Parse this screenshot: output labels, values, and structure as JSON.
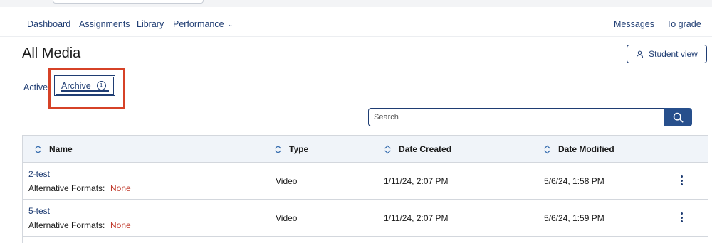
{
  "nav": {
    "left": [
      {
        "label": "Dashboard"
      },
      {
        "label": "Assignments"
      },
      {
        "label": "Library"
      },
      {
        "label": "Performance"
      }
    ],
    "right": [
      {
        "label": "Messages"
      },
      {
        "label": "To grade"
      }
    ]
  },
  "page": {
    "title": "All Media",
    "student_view_label": "Student view"
  },
  "tabs": {
    "active_label": "Active",
    "archive_label": "Archive",
    "selected": "Archive"
  },
  "search": {
    "placeholder": "Search"
  },
  "table": {
    "columns": [
      "Name",
      "Type",
      "Date Created",
      "Date Modified"
    ],
    "rows": [
      {
        "name": "2-test",
        "alt_label": "Alternative Formats:",
        "alt_value": "None",
        "type": "Video",
        "created": "1/11/24, 2:07 PM",
        "modified": "5/6/24, 1:58 PM"
      },
      {
        "name": "5-test",
        "alt_label": "Alternative Formats:",
        "alt_value": "None",
        "type": "Video",
        "created": "1/11/24, 2:07 PM",
        "modified": "5/6/24, 1:59 PM"
      }
    ]
  },
  "colors": {
    "accent": "#1f3d73",
    "search_button": "#274f8c",
    "highlight": "#d64227",
    "none_value": "#c0392b",
    "header_bg": "#f0f4f9"
  },
  "icons": {
    "sort": "sort-icon",
    "info": "info-icon",
    "search": "search-icon",
    "user": "user-icon",
    "more": "kebab-menu-icon",
    "chevron": "chevron-down-icon"
  }
}
